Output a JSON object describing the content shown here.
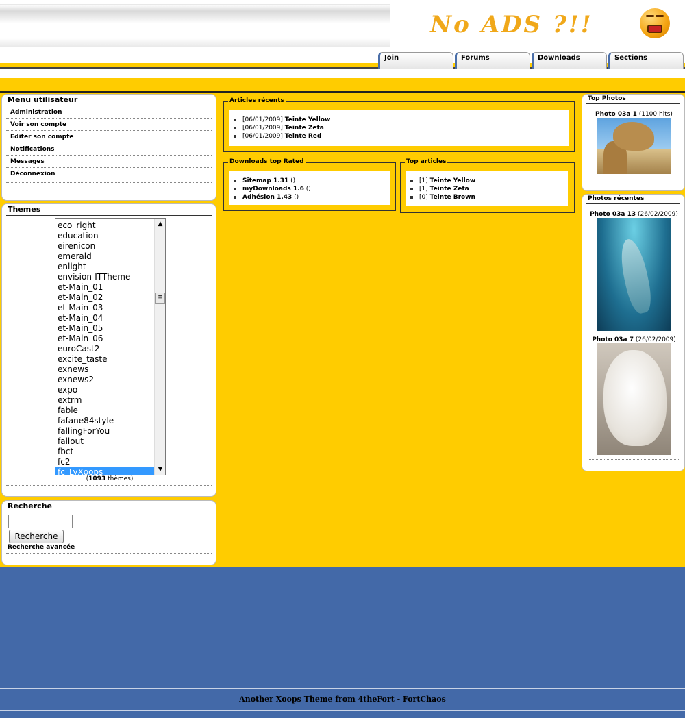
{
  "banner": {
    "text": "No ADS ?!!",
    "face_icon": "shocked-face-icon"
  },
  "nav": {
    "tabs": [
      "Join",
      "Forums",
      "Downloads",
      "Sections"
    ]
  },
  "user_menu": {
    "title": "Menu utilisateur",
    "items": [
      "Administration",
      "Voir son compte",
      "Editer son compte",
      "Notifications",
      "Messages",
      "Déconnexion"
    ]
  },
  "themes": {
    "title": "Themes",
    "options": [
      "eco_right",
      "education",
      "eirenicon",
      "emerald",
      "enlight",
      "envision-ITTheme",
      "et-Main_01",
      "et-Main_02",
      "et-Main_03",
      "et-Main_04",
      "et-Main_05",
      "et-Main_06",
      "euroCast2",
      "excite_taste",
      "exnews",
      "exnews2",
      "expo",
      "extrm",
      "fable",
      "fafane84style",
      "fallingForYou",
      "fallout",
      "fbct",
      "fc2",
      "fc_LyXoops"
    ],
    "selected": "fc_LyXoops",
    "count": "1093",
    "count_suffix": " thèmes)",
    "count_prefix": "("
  },
  "search": {
    "title": "Recherche",
    "input_value": "",
    "button_label": "Recherche",
    "advanced_link": "Recherche avancée"
  },
  "recent_articles": {
    "title": "Articles récents",
    "items": [
      {
        "date": "[06/01/2009]",
        "title": "Teinte Yellow",
        "suffix": " ()"
      },
      {
        "date": "[06/01/2009]",
        "title": "Teinte Zeta",
        "suffix": " ()"
      },
      {
        "date": "[06/01/2009]",
        "title": "Teinte Red",
        "suffix": " ()"
      }
    ]
  },
  "downloads_top": {
    "title": "Downloads top Rated",
    "items": [
      {
        "title": "Sitemap 1.31",
        "suffix": " ()"
      },
      {
        "title": "myDownloads 1.6",
        "suffix": " ()"
      },
      {
        "title": "Adhésion 1.43",
        "suffix": " ()"
      }
    ]
  },
  "top_articles": {
    "title": "Top articles",
    "items": [
      {
        "rank": "[1]",
        "title": "Teinte Yellow"
      },
      {
        "rank": "[1]",
        "title": "Teinte Zeta"
      },
      {
        "rank": "[0]",
        "title": "Teinte Brown"
      }
    ]
  },
  "top_photos": {
    "title": "Top Photos",
    "items": [
      {
        "name": "Photo 03a 1",
        "meta": " (1100 hits)",
        "subject": "camel"
      }
    ]
  },
  "recent_photos": {
    "title": "Photos récentes",
    "items": [
      {
        "name": "Photo 03a 13",
        "meta": " (26/02/2009)",
        "subject": "dolphin"
      },
      {
        "name": "Photo 03a 7",
        "meta": " (26/02/2009)",
        "subject": "polar bear"
      }
    ]
  },
  "footer": {
    "text": "Another Xoops Theme from 4theFort - FortChaos"
  },
  "colors": {
    "page_yellow": "#ffcc00",
    "footer_blue": "#4369a8",
    "selected_option": "#3399ff",
    "tab_accent": "#4a6ea8"
  }
}
